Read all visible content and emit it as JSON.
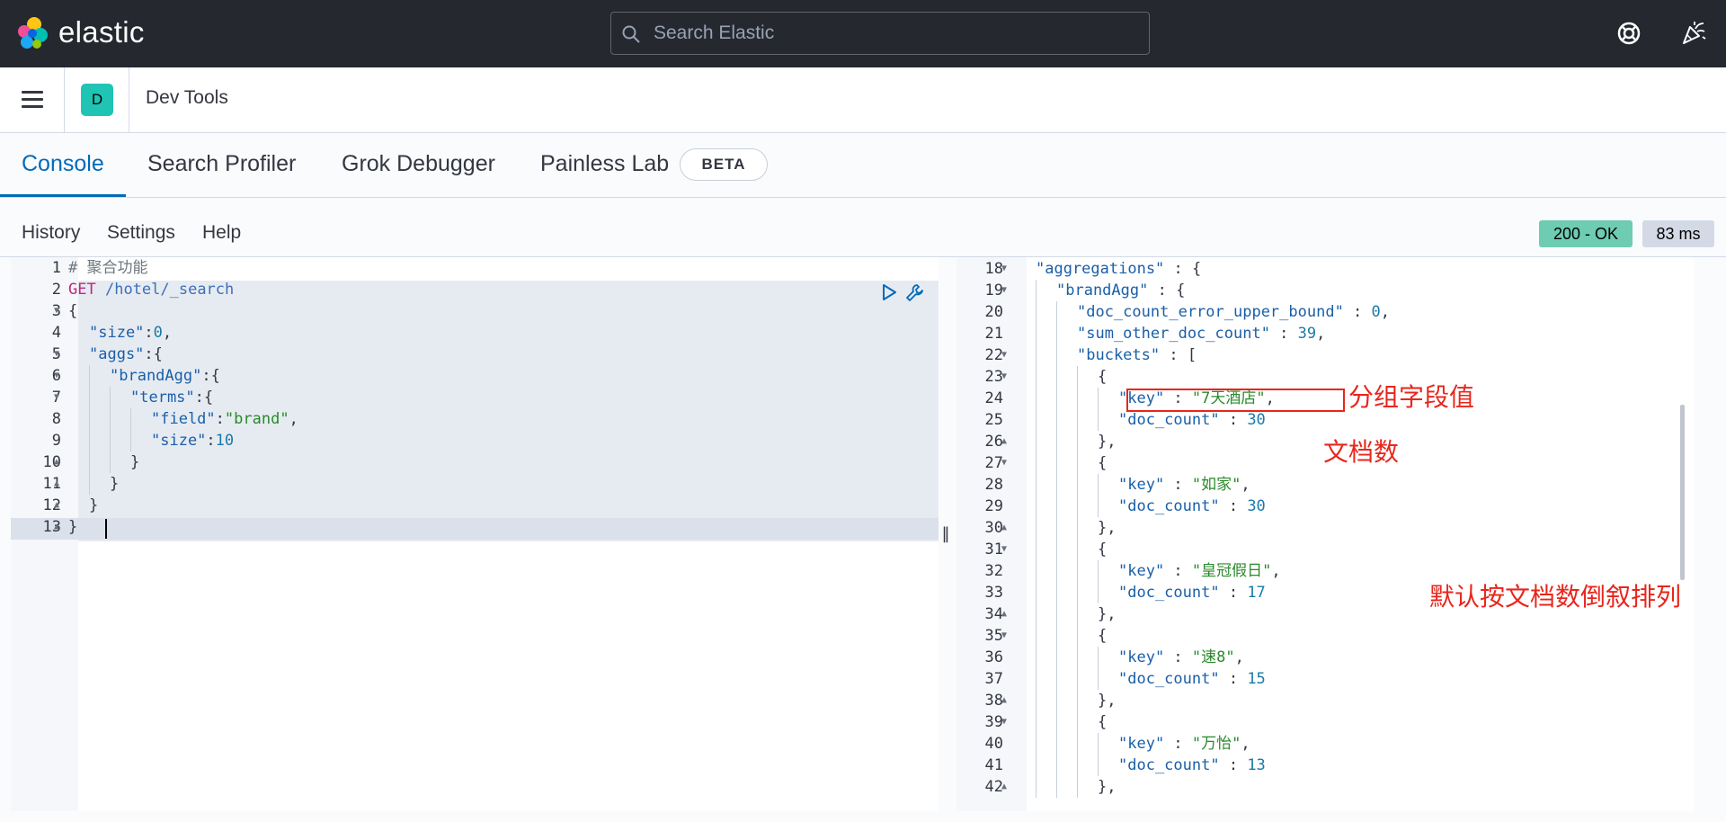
{
  "header": {
    "brand": "elastic",
    "search_placeholder": "Search Elastic"
  },
  "breadcrumb": {
    "space_initial": "D",
    "app": "Dev Tools"
  },
  "tabs": [
    {
      "label": "Console",
      "active": true
    },
    {
      "label": "Search Profiler",
      "active": false
    },
    {
      "label": "Grok Debugger",
      "active": false
    },
    {
      "label": "Painless Lab",
      "active": false
    }
  ],
  "beta_badge": "BETA",
  "toolbar": {
    "history": "History",
    "settings": "Settings",
    "help": "Help",
    "status": "200 - OK",
    "time": "83 ms"
  },
  "request": {
    "lines": [
      {
        "n": "1",
        "fold": "",
        "indent": 0,
        "tokens": [
          [
            "c-comment",
            "# 聚合功能"
          ]
        ]
      },
      {
        "n": "2",
        "fold": "",
        "indent": 0,
        "tokens": [
          [
            "c-method",
            "GET"
          ],
          [
            "c-punc",
            " "
          ],
          [
            "c-path",
            "/hotel/_search"
          ]
        ]
      },
      {
        "n": "3",
        "fold": "down",
        "indent": 0,
        "tokens": [
          [
            "c-punc",
            "{"
          ]
        ]
      },
      {
        "n": "4",
        "fold": "",
        "indent": 1,
        "tokens": [
          [
            "c-key",
            "\"size\""
          ],
          [
            "c-punc",
            ":"
          ],
          [
            "c-num",
            "0"
          ],
          [
            "c-punc",
            ","
          ]
        ]
      },
      {
        "n": "5",
        "fold": "down",
        "indent": 1,
        "tokens": [
          [
            "c-key",
            "\"aggs\""
          ],
          [
            "c-punc",
            ":{"
          ]
        ]
      },
      {
        "n": "6",
        "fold": "down",
        "indent": 2,
        "tokens": [
          [
            "c-key",
            "\"brandAgg\""
          ],
          [
            "c-punc",
            ":{"
          ]
        ]
      },
      {
        "n": "7",
        "fold": "down",
        "indent": 3,
        "tokens": [
          [
            "c-key",
            "\"terms\""
          ],
          [
            "c-punc",
            ":{"
          ]
        ]
      },
      {
        "n": "8",
        "fold": "",
        "indent": 4,
        "tokens": [
          [
            "c-key",
            "\"field\""
          ],
          [
            "c-punc",
            ":"
          ],
          [
            "c-str",
            "\"brand\""
          ],
          [
            "c-punc",
            ","
          ]
        ]
      },
      {
        "n": "9",
        "fold": "",
        "indent": 4,
        "tokens": [
          [
            "c-key",
            "\"size\""
          ],
          [
            "c-punc",
            ":"
          ],
          [
            "c-num",
            "10"
          ]
        ]
      },
      {
        "n": "10",
        "fold": "up",
        "indent": 3,
        "tokens": [
          [
            "c-punc",
            "}"
          ]
        ]
      },
      {
        "n": "11",
        "fold": "up",
        "indent": 2,
        "tokens": [
          [
            "c-punc",
            "}"
          ]
        ]
      },
      {
        "n": "12",
        "fold": "up",
        "indent": 1,
        "tokens": [
          [
            "c-punc",
            "}"
          ]
        ]
      },
      {
        "n": "13",
        "fold": "up",
        "indent": 0,
        "tokens": [
          [
            "c-punc",
            "}"
          ]
        ]
      }
    ]
  },
  "response": {
    "lines": [
      {
        "n": "18",
        "fold": "down",
        "indent": 1,
        "tokens": [
          [
            "c-key",
            "\"aggregations\""
          ],
          [
            "c-punc",
            " : {"
          ]
        ]
      },
      {
        "n": "19",
        "fold": "down",
        "indent": 2,
        "tokens": [
          [
            "c-key",
            "\"brandAgg\""
          ],
          [
            "c-punc",
            " : {"
          ]
        ]
      },
      {
        "n": "20",
        "fold": "",
        "indent": 3,
        "tokens": [
          [
            "c-key",
            "\"doc_count_error_upper_bound\""
          ],
          [
            "c-punc",
            " : "
          ],
          [
            "c-num",
            "0"
          ],
          [
            "c-punc",
            ","
          ]
        ]
      },
      {
        "n": "21",
        "fold": "",
        "indent": 3,
        "tokens": [
          [
            "c-key",
            "\"sum_other_doc_count\""
          ],
          [
            "c-punc",
            " : "
          ],
          [
            "c-num",
            "39"
          ],
          [
            "c-punc",
            ","
          ]
        ]
      },
      {
        "n": "22",
        "fold": "down",
        "indent": 3,
        "tokens": [
          [
            "c-key",
            "\"buckets\""
          ],
          [
            "c-punc",
            " : ["
          ]
        ]
      },
      {
        "n": "23",
        "fold": "down",
        "indent": 4,
        "tokens": [
          [
            "c-punc",
            "{"
          ]
        ]
      },
      {
        "n": "24",
        "fold": "",
        "indent": 5,
        "tokens": [
          [
            "c-key",
            "\"key\""
          ],
          [
            "c-punc",
            " : "
          ],
          [
            "c-str",
            "\"7天酒店\""
          ],
          [
            "c-punc",
            ","
          ]
        ]
      },
      {
        "n": "25",
        "fold": "",
        "indent": 5,
        "tokens": [
          [
            "c-key",
            "\"doc_count\""
          ],
          [
            "c-punc",
            " : "
          ],
          [
            "c-num",
            "30"
          ]
        ]
      },
      {
        "n": "26",
        "fold": "up",
        "indent": 4,
        "tokens": [
          [
            "c-punc",
            "},"
          ]
        ]
      },
      {
        "n": "27",
        "fold": "down",
        "indent": 4,
        "tokens": [
          [
            "c-punc",
            "{"
          ]
        ]
      },
      {
        "n": "28",
        "fold": "",
        "indent": 5,
        "tokens": [
          [
            "c-key",
            "\"key\""
          ],
          [
            "c-punc",
            " : "
          ],
          [
            "c-str",
            "\"如家\""
          ],
          [
            "c-punc",
            ","
          ]
        ]
      },
      {
        "n": "29",
        "fold": "",
        "indent": 5,
        "tokens": [
          [
            "c-key",
            "\"doc_count\""
          ],
          [
            "c-punc",
            " : "
          ],
          [
            "c-num",
            "30"
          ]
        ]
      },
      {
        "n": "30",
        "fold": "up",
        "indent": 4,
        "tokens": [
          [
            "c-punc",
            "},"
          ]
        ]
      },
      {
        "n": "31",
        "fold": "down",
        "indent": 4,
        "tokens": [
          [
            "c-punc",
            "{"
          ]
        ]
      },
      {
        "n": "32",
        "fold": "",
        "indent": 5,
        "tokens": [
          [
            "c-key",
            "\"key\""
          ],
          [
            "c-punc",
            " : "
          ],
          [
            "c-str",
            "\"皇冠假日\""
          ],
          [
            "c-punc",
            ","
          ]
        ]
      },
      {
        "n": "33",
        "fold": "",
        "indent": 5,
        "tokens": [
          [
            "c-key",
            "\"doc_count\""
          ],
          [
            "c-punc",
            " : "
          ],
          [
            "c-num",
            "17"
          ]
        ]
      },
      {
        "n": "34",
        "fold": "up",
        "indent": 4,
        "tokens": [
          [
            "c-punc",
            "},"
          ]
        ]
      },
      {
        "n": "35",
        "fold": "down",
        "indent": 4,
        "tokens": [
          [
            "c-punc",
            "{"
          ]
        ]
      },
      {
        "n": "36",
        "fold": "",
        "indent": 5,
        "tokens": [
          [
            "c-key",
            "\"key\""
          ],
          [
            "c-punc",
            " : "
          ],
          [
            "c-str",
            "\"速8\""
          ],
          [
            "c-punc",
            ","
          ]
        ]
      },
      {
        "n": "37",
        "fold": "",
        "indent": 5,
        "tokens": [
          [
            "c-key",
            "\"doc_count\""
          ],
          [
            "c-punc",
            " : "
          ],
          [
            "c-num",
            "15"
          ]
        ]
      },
      {
        "n": "38",
        "fold": "up",
        "indent": 4,
        "tokens": [
          [
            "c-punc",
            "},"
          ]
        ]
      },
      {
        "n": "39",
        "fold": "down",
        "indent": 4,
        "tokens": [
          [
            "c-punc",
            "{"
          ]
        ]
      },
      {
        "n": "40",
        "fold": "",
        "indent": 5,
        "tokens": [
          [
            "c-key",
            "\"key\""
          ],
          [
            "c-punc",
            " : "
          ],
          [
            "c-str",
            "\"万怡\""
          ],
          [
            "c-punc",
            ","
          ]
        ]
      },
      {
        "n": "41",
        "fold": "",
        "indent": 5,
        "tokens": [
          [
            "c-key",
            "\"doc_count\""
          ],
          [
            "c-punc",
            " : "
          ],
          [
            "c-num",
            "13"
          ]
        ]
      },
      {
        "n": "42",
        "fold": "up",
        "indent": 4,
        "tokens": [
          [
            "c-punc",
            "},"
          ]
        ]
      }
    ]
  },
  "annotations": {
    "group_value": "分组字段值",
    "doc_count": "文档数",
    "sort_note": "默认按文档数倒叙排列"
  },
  "colors": {
    "header_bg": "#25282f",
    "accent": "#006bb8",
    "status_ok": "#6dccb1",
    "annotation_red": "#e8261c"
  }
}
